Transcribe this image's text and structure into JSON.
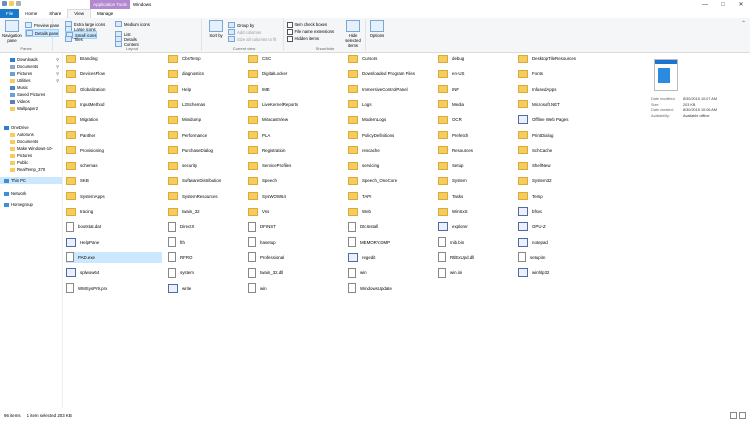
{
  "title": {
    "context_tab": "Application Tools",
    "window": "Windows"
  },
  "window_buttons": {
    "minimize": "—",
    "maximize": "□",
    "close": "✕"
  },
  "tabs": [
    {
      "label": "File",
      "kind": "file"
    },
    {
      "label": "Home",
      "kind": ""
    },
    {
      "label": "Share",
      "kind": ""
    },
    {
      "label": "View",
      "kind": "active"
    }
  ],
  "manage_tab": "Manage",
  "ribbon": {
    "panes": {
      "nav": "Navigation pane",
      "preview": "Preview pane",
      "details": "Details pane",
      "label": "Panes"
    },
    "layout": {
      "items": [
        "Extra large icons",
        "Large icons",
        "Medium icons",
        "Small icons",
        "List",
        "Details",
        "Tiles",
        "Content"
      ],
      "label": "Layout"
    },
    "current_view": {
      "sort": "Sort by",
      "group": "Group by",
      "add_columns": "Add columns",
      "size_all": "Size all columns to fit",
      "label": "Current view"
    },
    "show_hide": {
      "checkboxes": "Item check boxes",
      "extensions": "File name extensions",
      "hidden": "Hidden items",
      "hide_selected": "Hide selected items",
      "label": "Show/hide"
    },
    "options": "Options"
  },
  "nav": [
    {
      "label": "Downloads",
      "pinned": true,
      "kind": "blue"
    },
    {
      "label": "Documents",
      "pinned": true,
      "kind": "doc"
    },
    {
      "label": "Pictures",
      "pinned": true,
      "kind": "pic"
    },
    {
      "label": "Utilities",
      "pinned": true,
      "kind": "folder"
    },
    {
      "label": "Music",
      "pinned": false,
      "kind": "music"
    },
    {
      "label": "Saved Pictures",
      "pinned": false,
      "kind": "pic"
    },
    {
      "label": "Videos",
      "pinned": false,
      "kind": "video"
    },
    {
      "label": "Wallpaper2",
      "pinned": false,
      "kind": "folder"
    },
    {
      "label": "OneDrive",
      "pinned": false,
      "kind": "cloud"
    },
    {
      "label": "Autoruns",
      "pinned": false,
      "kind": "folder"
    },
    {
      "label": "Documents",
      "pinned": false,
      "kind": "folder"
    },
    {
      "label": "Make Windows-10-",
      "pinned": false,
      "kind": "folder"
    },
    {
      "label": "Pictures",
      "pinned": false,
      "kind": "folder"
    },
    {
      "label": "Public",
      "pinned": false,
      "kind": "folder"
    },
    {
      "label": "RealTemp_370",
      "pinned": false,
      "kind": "folder"
    },
    {
      "label": "This PC",
      "pinned": false,
      "kind": "pc"
    },
    {
      "label": "Network",
      "pinned": false,
      "kind": "net"
    },
    {
      "label": "Homegroup",
      "pinned": false,
      "kind": "home"
    }
  ],
  "columns": [
    [
      "Branding",
      "DevicesFlow",
      "Globalization",
      "InputMethod",
      "Migration",
      "Panther",
      "Provisioning",
      "schemas",
      "SKB",
      "SystemApps",
      "tracing",
      "bootstat.dat",
      "HelpPane",
      "PAD.exe",
      "splwow64",
      "WMSysPr9.prx"
    ],
    [
      "CbsTemp",
      "diagnostics",
      "Help",
      "L2Schemas",
      "Minidump",
      "Performance",
      "PurchaseDialog",
      "security",
      "SoftwareDistribution",
      "SystemResources",
      "twain_32",
      "DirectX",
      "fth",
      "RFRO",
      "system",
      "write"
    ],
    [
      "CSC",
      "DigitalLocker",
      "IME",
      "LiveKernelReports",
      "MiracastView",
      "PLA",
      "Registration",
      "ServiceProfiles",
      "Speech",
      "SysWOW64",
      "Vss",
      "DFINST",
      "hasetup",
      "Professional",
      "twain_32.dll",
      "win"
    ],
    [
      "Cursors",
      "Downloaded Program Files",
      "ImmersiveControlPanel",
      "Logs",
      "ModemLogs",
      "PolicyDefinitions",
      "rescache",
      "servicing",
      "Speech_OneCore",
      "TAPI",
      "Web",
      "DtcInstall",
      "MEMORY.DMP",
      "regedit",
      "win",
      "WindowsUpdate"
    ],
    [
      "debug",
      "en-US",
      "INF",
      "Media",
      "OCR",
      "Prefetch",
      "Resources",
      "Setup",
      "System",
      "Tasks",
      "WinSxS",
      "explorer",
      "mib.bin",
      "RtlExUpd.dll",
      "win.ini"
    ],
    [
      "DesktopTileResources",
      "Fonts",
      "InfusedApps",
      "Microsoft.NET",
      "Offline Web Pages",
      "PrintDialog",
      "SchCache",
      "ShellNew",
      "System32",
      "Temp",
      "bfsvc",
      "GPU-Z",
      "notepad",
      "setupim",
      "winhlp32"
    ]
  ],
  "column_kinds": [
    [
      "f",
      "f",
      "f",
      "f",
      "f",
      "f",
      "f",
      "f",
      "f",
      "f",
      "f",
      "d",
      "a",
      "d",
      "a",
      "d"
    ],
    [
      "f",
      "f",
      "f",
      "f",
      "f",
      "f",
      "f",
      "f",
      "f",
      "f",
      "f",
      "d",
      "d",
      "d",
      "d",
      "a"
    ],
    [
      "f",
      "f",
      "f",
      "f",
      "f",
      "f",
      "f",
      "f",
      "f",
      "f",
      "f",
      "d",
      "d",
      "d",
      "d",
      "d"
    ],
    [
      "f",
      "f",
      "f",
      "f",
      "f",
      "f",
      "f",
      "f",
      "f",
      "f",
      "f",
      "d",
      "d",
      "a",
      "d",
      "d"
    ],
    [
      "f",
      "f",
      "f",
      "f",
      "f",
      "f",
      "f",
      "f",
      "f",
      "f",
      "f",
      "a",
      "d",
      "d",
      "d"
    ],
    [
      "f",
      "f",
      "f",
      "f",
      "a",
      "f",
      "f",
      "f",
      "f",
      "f",
      "a",
      "a",
      "a",
      "d",
      "a"
    ]
  ],
  "selected": "PAD.exe",
  "details": [
    {
      "label": "Date modified:",
      "value": "8/30/2015 10:07 AM"
    },
    {
      "label": "Size:",
      "value": "203 KB"
    },
    {
      "label": "Date created:",
      "value": "8/30/2015 10:06 AM"
    },
    {
      "label": "Availability:",
      "value": "Available offline"
    }
  ],
  "status": {
    "count": "96 items",
    "selection": "1 item selected  203 KB"
  },
  "colors": {
    "file_tab": "#1979ca",
    "app_tools": "#b288d1",
    "selection": "#cce8ff",
    "folder": "#f5cd5d"
  }
}
